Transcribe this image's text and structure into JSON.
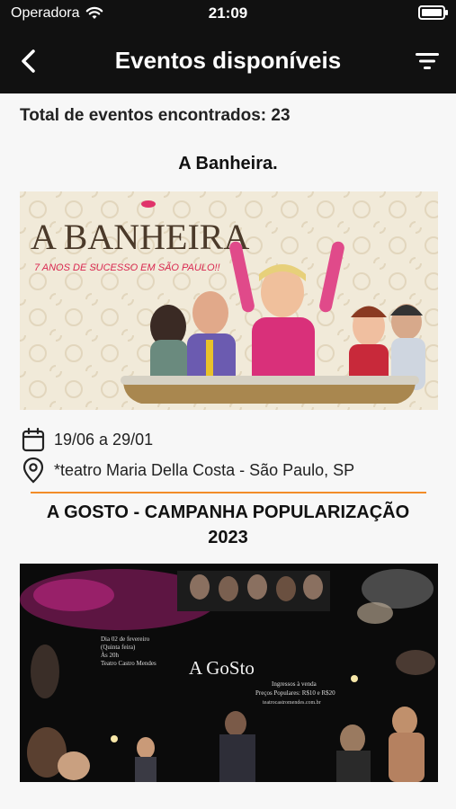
{
  "status_bar": {
    "carrier": "Operadora",
    "time": "21:09"
  },
  "header": {
    "title": "Eventos disponíveis",
    "back_icon": "chevron-left-icon",
    "filter_icon": "filter-icon"
  },
  "summary": {
    "total_label": "Total de eventos encontrados: 23"
  },
  "events": [
    {
      "title": "A Banheira.",
      "poster": {
        "headline": "A BANHEIRA",
        "tagline": "7 ANOS DE SUCESSO EM SÃO PAULO!!"
      },
      "date": "19/06 a 29/01",
      "location": "*teatro Maria Della Costa - São Paulo, SP"
    },
    {
      "title": "A GOSTO - CAMPANHA POPULARIZAÇÃO 2023",
      "poster": {
        "headline": "A GoSto",
        "info_left": [
          "Dia 02 de fevereiro",
          "(Quinta feira)",
          "Às 20h",
          "Teatro Castro Mendes"
        ],
        "info_right": [
          "Ingressos à venda",
          "Preços Populares: R$10 e R$20",
          "teatrocastromendes.com.br"
        ]
      }
    }
  ],
  "colors": {
    "header_bg": "#111111",
    "divider": "#f28c28",
    "background": "#f7f7f7"
  }
}
